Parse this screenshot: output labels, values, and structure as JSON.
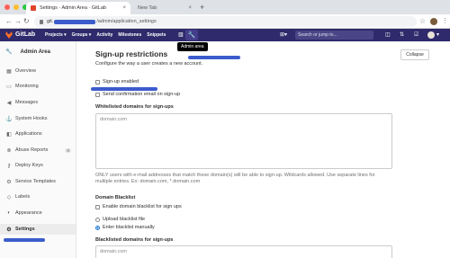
{
  "browser": {
    "tabs": [
      {
        "title": "Settings · Admin Area · GitLab",
        "active": true
      },
      {
        "title": "New Tab",
        "active": false
      }
    ],
    "url_prefix": "git.",
    "url_path": "/admin/application_settings",
    "traffic_colors": [
      "#ff5f57",
      "#febc2e",
      "#28c840"
    ]
  },
  "header": {
    "brand": "GitLab",
    "nav": [
      "Projects ▾",
      "Groups ▾",
      "Activity",
      "Milestones",
      "Snippets"
    ],
    "search_placeholder": "Search or jump to...",
    "tooltip": "Admin area",
    "accent": "#2f2a6b"
  },
  "sidebar": {
    "title": "Admin Area",
    "items": [
      {
        "label": "Overview",
        "icon": "grid-icon"
      },
      {
        "label": "Monitoring",
        "icon": "monitor-icon"
      },
      {
        "label": "Messages",
        "icon": "megaphone-icon"
      },
      {
        "label": "System Hooks",
        "icon": "hook-icon"
      },
      {
        "label": "Applications",
        "icon": "apps-icon"
      },
      {
        "label": "Abuse Reports",
        "icon": "alert-icon",
        "badge": "0"
      },
      {
        "label": "Deploy Keys",
        "icon": "key-icon"
      },
      {
        "label": "Service Templates",
        "icon": "template-icon"
      },
      {
        "label": "Labels",
        "icon": "label-icon"
      },
      {
        "label": "Appearance",
        "icon": "palette-icon"
      },
      {
        "label": "Settings",
        "icon": "gear-icon",
        "active": true
      }
    ]
  },
  "main": {
    "section_title": "Sign-up restrictions",
    "collapse_label": "Collapse",
    "description": "Configure the way a user creates a new account.",
    "signup_enabled_label": "Sign-up enabled",
    "send_confirmation_label": "Send confirmation email on sign-up",
    "whitelist_label": "Whitelisted domains for sign-ups",
    "whitelist_placeholder": "domain.com",
    "whitelist_help": "ONLY users with e-mail addresses that match these domain(s) will be able to sign-up. Wildcards allowed. Use separate lines for multiple entries. Ex: domain.com, *.domain.com",
    "blacklist_section_label": "Domain Blacklist",
    "enable_blacklist_label": "Enable domain blacklist for sign ups",
    "upload_blacklist_label": "Upload blacklist file",
    "enter_blacklist_label": "Enter blacklist manually",
    "blacklisted_domains_label": "Blacklisted domains for sign-ups",
    "blacklisted_placeholder": "domain.com"
  }
}
